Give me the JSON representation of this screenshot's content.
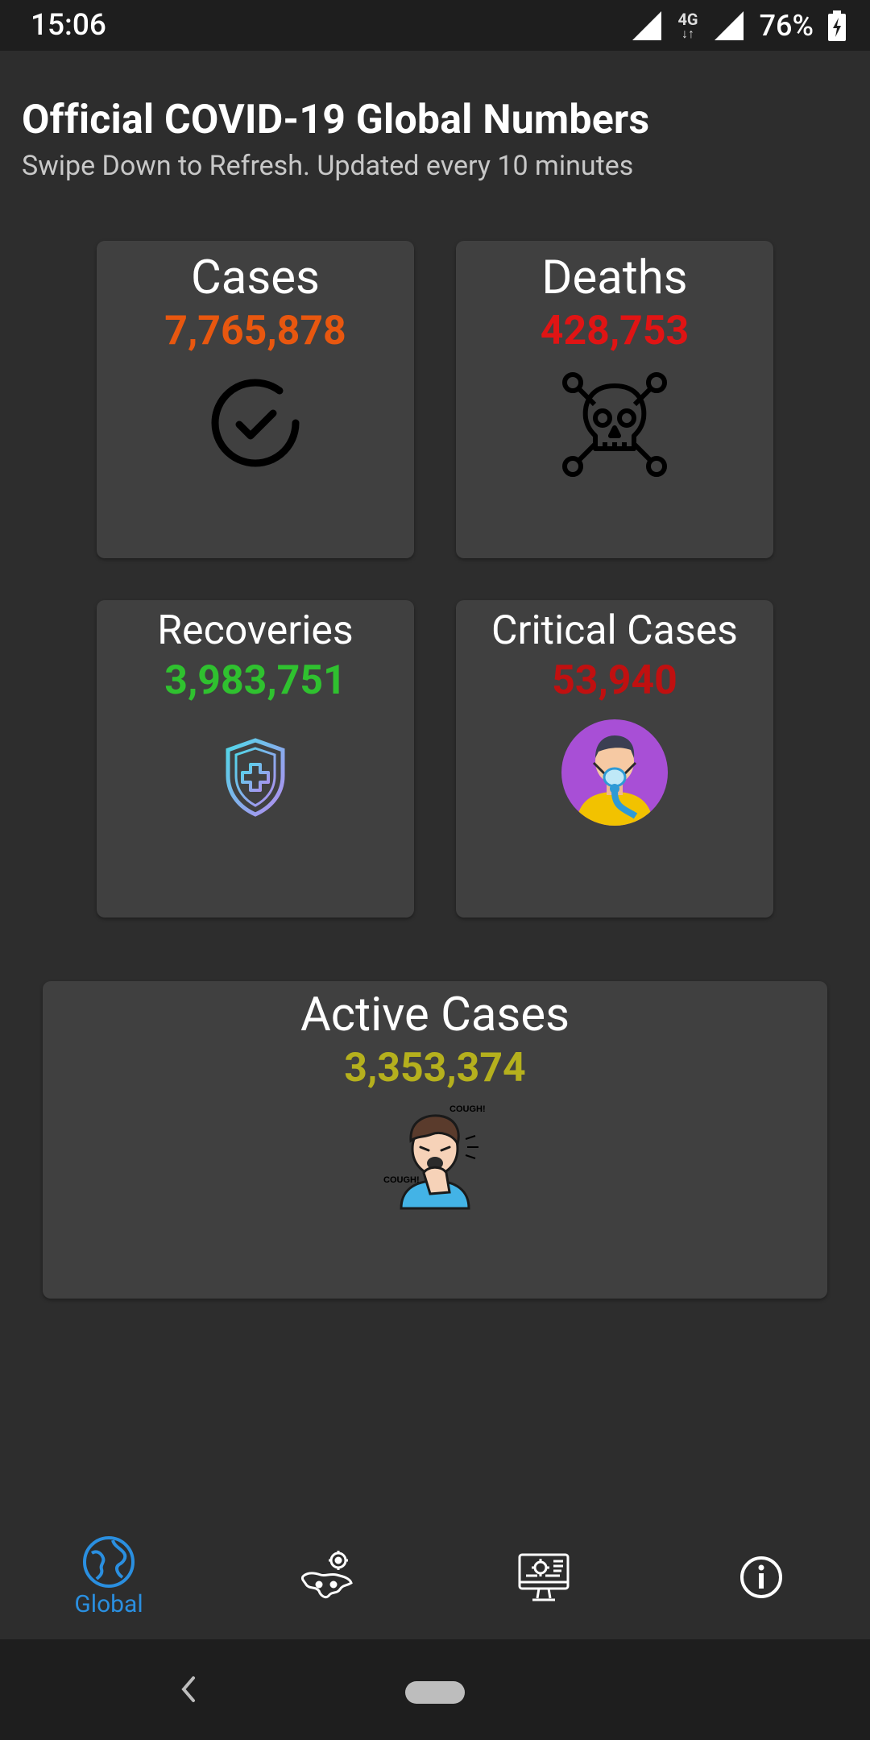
{
  "status_bar": {
    "time": "15:06",
    "network": "4G",
    "battery": "76%"
  },
  "header": {
    "title": "Official COVID-19 Global Numbers",
    "subtitle": "Swipe Down to Refresh. Updated every 10 minutes"
  },
  "cards": {
    "cases": {
      "label": "Cases",
      "value": "7,765,878",
      "color": "#e8570f",
      "icon": "check-circle-icon"
    },
    "deaths": {
      "label": "Deaths",
      "value": "428,753",
      "color": "#e01414",
      "icon": "skull-crossbones-icon"
    },
    "recoveries": {
      "label": "Recoveries",
      "value": "3,983,751",
      "color": "#2fc12f",
      "icon": "shield-plus-icon"
    },
    "critical": {
      "label": "Critical Cases",
      "value": "53,940",
      "color": "#c01010",
      "icon": "patient-oxygen-mask-icon"
    },
    "active": {
      "label": "Active Cases",
      "value": "3,353,374",
      "color": "#b5b01d",
      "icon": "coughing-person-icon"
    }
  },
  "bottom_nav": {
    "items": [
      {
        "label": "Global",
        "icon": "globe-icon",
        "active": true
      },
      {
        "label": "",
        "icon": "world-map-virus-icon",
        "active": false
      },
      {
        "label": "",
        "icon": "computer-virus-icon",
        "active": false
      },
      {
        "label": "",
        "icon": "info-icon",
        "active": false
      }
    ],
    "active_color": "#2a8fe0"
  }
}
